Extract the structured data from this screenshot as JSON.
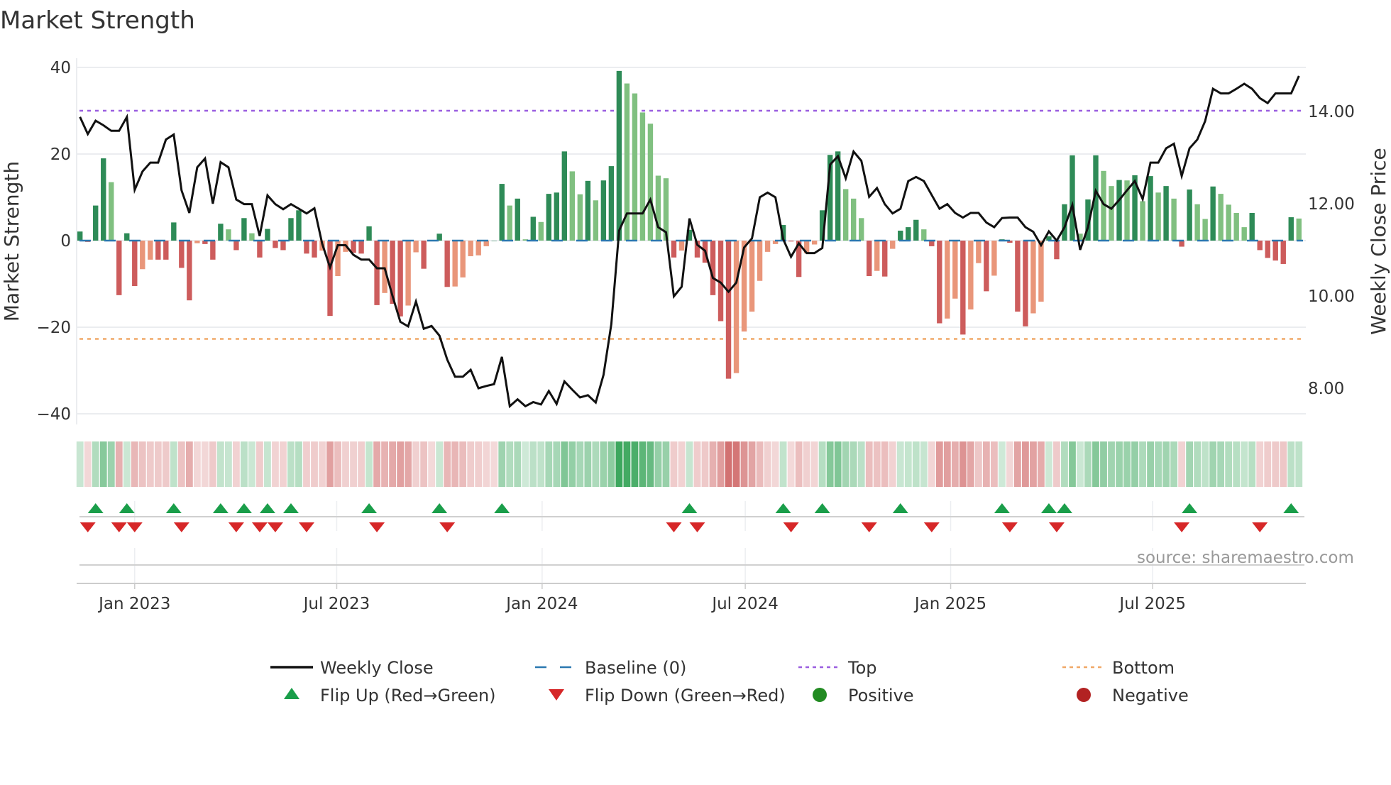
{
  "chart_data": {
    "type": "bar",
    "title": "Market Strength",
    "ylabel": "Market Strength",
    "y2label": "Weekly Close Price",
    "ylim": [
      -42.2,
      42.4
    ],
    "y2lim": [
      7.22,
      15.15
    ],
    "yticks": [
      {
        "v": 40,
        "label": "40"
      },
      {
        "v": 20,
        "label": "20"
      },
      {
        "v": 0,
        "label": "0"
      },
      {
        "v": -20,
        "label": "−20"
      },
      {
        "v": -40,
        "label": "−40"
      }
    ],
    "y2ticks": [
      {
        "v": 14,
        "label": "14.00"
      },
      {
        "v": 12,
        "label": "12.00"
      },
      {
        "v": 10,
        "label": "10.00"
      },
      {
        "v": 8,
        "label": "8.00"
      }
    ],
    "x_start": "2022-11-13",
    "x_step_days": 7,
    "xticks": [
      {
        "date": "2023-01-01",
        "label": "Jan 2023"
      },
      {
        "date": "2023-07-01",
        "label": "Jul 2023"
      },
      {
        "date": "2024-01-01",
        "label": "Jan 2024"
      },
      {
        "date": "2024-07-01",
        "label": "Jul 2024"
      },
      {
        "date": "2025-01-01",
        "label": "Jan 2025"
      },
      {
        "date": "2025-07-01",
        "label": "Jul 2025"
      }
    ],
    "top_level": 30,
    "bottom_level": -22.7,
    "baseline": 0,
    "grid": true,
    "legend_position": "bottom",
    "series": [
      {
        "name": "Market Strength",
        "type": "bar",
        "values": [
          2.1,
          -0.3,
          8.1,
          19.0,
          13.5,
          -12.6,
          1.7,
          -10.5,
          -6.6,
          -4.4,
          -4.4,
          -4.4,
          4.2,
          -6.3,
          -13.8,
          -0.6,
          -0.8,
          -4.4,
          3.9,
          2.6,
          -2.2,
          5.2,
          1.7,
          -3.9,
          2.7,
          -1.7,
          -2.2,
          5.2,
          7.0,
          -3.0,
          -3.9,
          -2.3,
          -17.4,
          -8.2,
          -2.6,
          -2.8,
          -3.0,
          3.3,
          -14.9,
          -12.1,
          -14.6,
          -17.5,
          -15.0,
          -2.7,
          -6.5,
          0,
          1.6,
          -10.7,
          -10.6,
          -8.5,
          -3.6,
          -3.4,
          -1.3,
          0,
          13.1,
          8.1,
          9.7,
          0.3,
          5.5,
          4.3,
          10.8,
          11.1,
          20.6,
          16.0,
          10.7,
          13.8,
          9.3,
          13.9,
          17.2,
          39.2,
          36.3,
          34.0,
          29.6,
          27.0,
          15.0,
          14.4,
          -3.9,
          -2.3,
          2.5,
          -3.9,
          -5.1,
          -12.6,
          -18.6,
          -31.9,
          -30.6,
          -21.0,
          -16.4,
          -9.3,
          -2.6,
          -0.8,
          3.6,
          -0.2,
          -8.4,
          -2.9,
          -0.9,
          7.0,
          19.8,
          20.6,
          11.9,
          9.7,
          5.2,
          -8.2,
          -7.0,
          -8.3,
          -1.9,
          2.3,
          3.1,
          4.8,
          2.6,
          -1.3,
          -19.1,
          -18.0,
          -13.4,
          -21.7,
          -15.9,
          -5.2,
          -11.7,
          -8.1,
          0.3,
          -0.5,
          -16.4,
          -19.8,
          -16.8,
          -14.1,
          1.0,
          -4.3,
          8.4,
          19.7,
          1.6,
          9.5,
          19.7,
          16.1,
          12.6,
          14.0,
          13.9,
          15.1,
          9.1,
          14.9,
          11.1,
          12.6,
          9.7,
          -1.4,
          11.8,
          8.4,
          5.0,
          12.5,
          10.8,
          8.3,
          6.4,
          3.1,
          6.4,
          -2.2,
          -4.0,
          -4.6,
          -5.4,
          5.4,
          5.1
        ]
      },
      {
        "name": "Weekly Close",
        "type": "line",
        "axis": "right",
        "values": [
          13.88,
          13.51,
          13.8,
          13.7,
          13.58,
          13.58,
          13.88,
          12.3,
          12.7,
          12.89,
          12.89,
          13.39,
          13.5,
          12.29,
          11.8,
          12.79,
          12.98,
          12.0,
          12.9,
          12.79,
          12.09,
          11.99,
          11.99,
          11.3,
          12.18,
          11.99,
          11.88,
          11.99,
          11.89,
          11.79,
          11.9,
          11.13,
          10.62,
          11.1,
          11.1,
          10.89,
          10.79,
          10.79,
          10.6,
          10.6,
          10.0,
          9.44,
          9.34,
          9.88,
          9.29,
          9.35,
          9.14,
          8.62,
          8.25,
          8.25,
          8.4,
          8.0,
          8.05,
          8.09,
          8.68,
          7.61,
          7.76,
          7.61,
          7.7,
          7.65,
          7.94,
          7.66,
          8.15,
          7.97,
          7.8,
          7.85,
          7.69,
          8.29,
          9.39,
          11.42,
          11.79,
          11.79,
          11.79,
          12.09,
          11.49,
          11.38,
          9.99,
          10.2,
          11.68,
          11.11,
          10.98,
          10.39,
          10.29,
          10.09,
          10.29,
          11.05,
          11.25,
          12.14,
          12.24,
          12.14,
          11.23,
          10.85,
          11.14,
          10.93,
          10.93,
          11.04,
          12.85,
          13.03,
          12.55,
          13.13,
          12.93,
          12.15,
          12.34,
          11.99,
          11.79,
          11.89,
          12.49,
          12.58,
          12.49,
          12.19,
          11.89,
          11.99,
          11.8,
          11.7,
          11.8,
          11.8,
          11.59,
          11.49,
          11.69,
          11.7,
          11.7,
          11.49,
          11.39,
          11.1,
          11.4,
          11.2,
          11.49,
          11.97,
          11.0,
          11.49,
          12.28,
          11.99,
          11.89,
          12.08,
          12.29,
          12.49,
          12.1,
          12.89,
          12.89,
          13.2,
          13.3,
          12.6,
          13.2,
          13.39,
          13.79,
          14.49,
          14.39,
          14.39,
          14.49,
          14.6,
          14.49,
          14.29,
          14.18,
          14.39,
          14.39,
          14.39,
          14.77
        ]
      }
    ],
    "legend": [
      {
        "label": "Weekly Close",
        "symbol": "line"
      },
      {
        "label": "Baseline (0)",
        "symbol": "dash"
      },
      {
        "label": "Top",
        "symbol": "dot-purple"
      },
      {
        "label": "Bottom",
        "symbol": "dot-orange"
      },
      {
        "label": "Flip Up (Red→Green)",
        "symbol": "triangle-up"
      },
      {
        "label": "Flip Down (Green→Red)",
        "symbol": "triangle-down"
      },
      {
        "label": "Positive",
        "symbol": "circle-green"
      },
      {
        "label": "Negative",
        "symbol": "circle-red"
      }
    ],
    "source": "source: sharemaestro.com"
  },
  "colors": {
    "pos_up": "#2e8b57",
    "pos_down": "#80c080",
    "neg_down": "#cd5c5c",
    "neg_up": "#e9967a",
    "baseline": "#2b78b0",
    "top": "#9b5fe0",
    "bottom": "#f0a868",
    "line": "#111111",
    "flip_up": "#1a9e4a",
    "flip_down": "#d62728",
    "positive": "#228b22",
    "negative": "#b22222",
    "grid": "#ebedf0"
  }
}
